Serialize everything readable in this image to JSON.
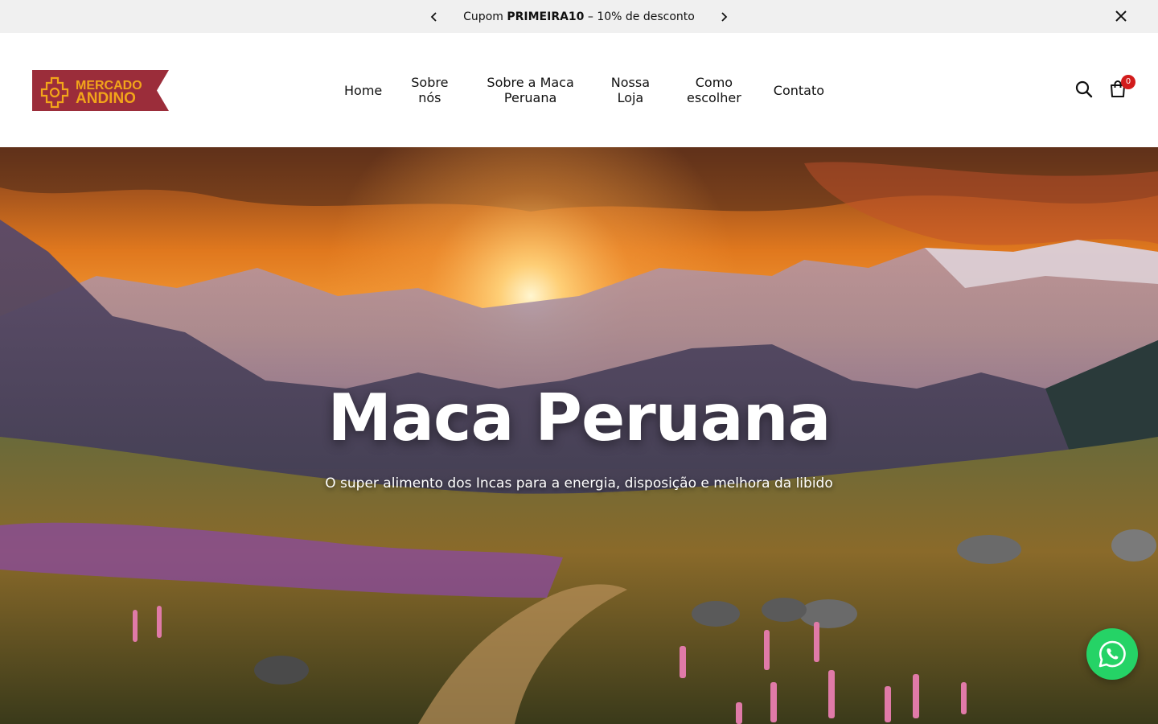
{
  "announcement": {
    "prefix": "Cupom",
    "code": "PRIMEIRA10",
    "suffix": "– 10% de desconto"
  },
  "logo": {
    "line1": "MERCADO",
    "line2": "ANDINO",
    "brand_color": "#9b2d3a",
    "accent_color": "#f2a51a"
  },
  "nav": {
    "items": [
      {
        "line1": "Home",
        "line2": ""
      },
      {
        "line1": "Sobre",
        "line2": "nós"
      },
      {
        "line1": "Sobre a Maca",
        "line2": "Peruana"
      },
      {
        "line1": "Nossa",
        "line2": "Loja"
      },
      {
        "line1": "Como",
        "line2": "escolher"
      },
      {
        "line1": "Contato",
        "line2": ""
      }
    ]
  },
  "header": {
    "search_icon": "search-icon",
    "cart_icon": "shopping-bag-icon",
    "cart_count": "0"
  },
  "hero": {
    "title": "Maca Peruana",
    "subtitle": "O super alimento dos Incas para a energia, disposição e melhora da libido"
  },
  "whatsapp": {
    "icon": "whatsapp-icon",
    "color": "#25d366"
  }
}
